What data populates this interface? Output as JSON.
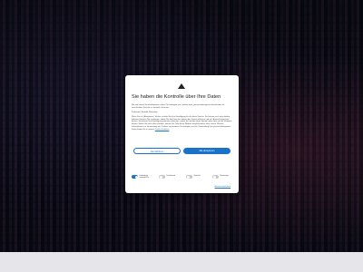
{
  "consent": {
    "title": "Sie haben die Kontrolle über Ihre Daten",
    "intro": "Wir und unsere Geschäftspartner nutzen Technologien wie Cookies dazu, personenbezogene Informationen für verschiedene Zwecke zu sammeln, darunter:",
    "purposes": "Funktional, Statistik, Marketing",
    "details": "Wenn Sie auf „Akzeptieren“ klicken, erteilen Sie Ihre Einwilligung für alle diese Zwecke. Sie können auch entscheiden, welchen Zwecken Sie zustimmen, indem Sie das Kästchen neben dem Zweck anklicken und auf „Auswahl speichern“ klicken. Sie können Ihre Einwilligung jederzeit widerrufen, indem Sie auf das kleine Symbol unten links auf der Webseite klicken. Sofern Sie nicht alles erlauben, können Sie Teile dieser Website möglicherweise nicht nutzen. Weitere Informationen zur Verwendung von Cookies und anderen Technologien und zur Verwendung Ihrer personenbezogenen Daten finden Sie in unserer",
    "details_link": "Cookie-Richtlinie",
    "reject_label": "Alle ablehnen",
    "accept_label": "Alle akzeptieren",
    "save_label": "Auswahl speichern",
    "toggles": [
      {
        "label": "Unbedingt erforderlich",
        "on": true
      },
      {
        "label": "Funktional",
        "on": false
      },
      {
        "label": "Statistik",
        "on": false
      },
      {
        "label": "Marketing",
        "on": false
      }
    ]
  },
  "colors": {
    "accent": "#1a73c9",
    "backdrop": "#000000"
  },
  "icons": {
    "logo": "brand-logo-icon"
  }
}
